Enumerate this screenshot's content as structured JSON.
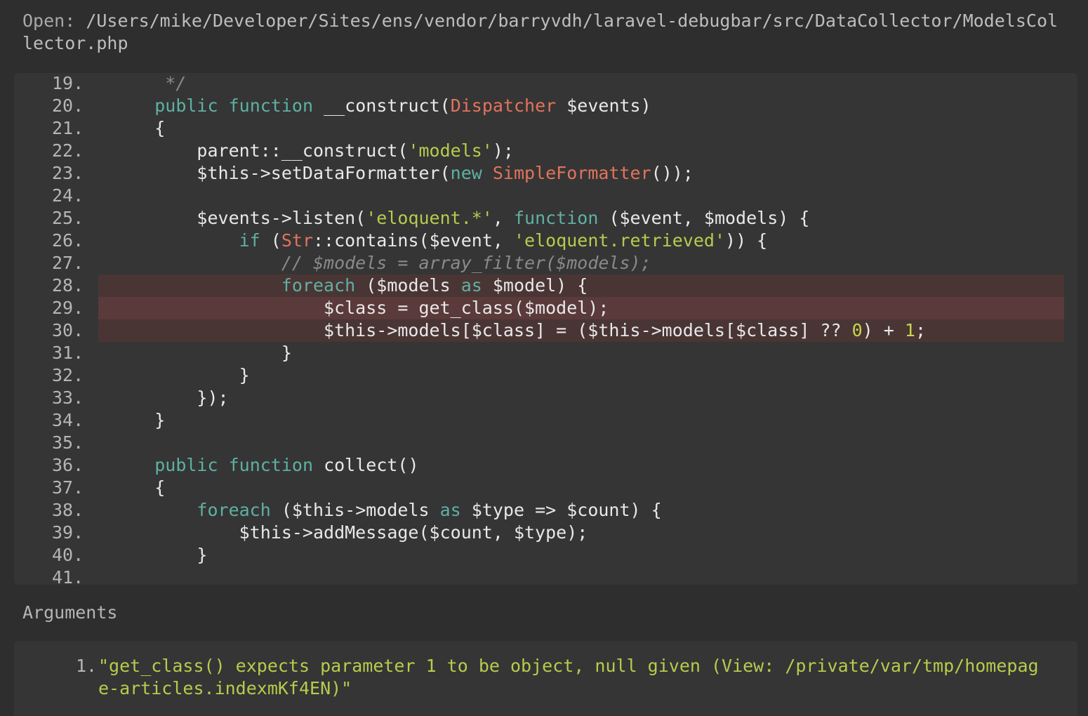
{
  "header": {
    "open_label": "Open:",
    "path": "/Users/mike/Developer/Sites/ens/vendor/barryvdh/laravel-debugbar/src/DataCollector/ModelsCollector.php"
  },
  "code": {
    "highlight_lines": [
      "28",
      "29",
      "30"
    ],
    "active_line": "29",
    "lines": [
      {
        "num": "19.",
        "tokens": [
          {
            "t": "     */",
            "c": "c"
          }
        ]
      },
      {
        "num": "20.",
        "tokens": [
          {
            "t": "    ",
            "c": ""
          },
          {
            "t": "public",
            "c": "k"
          },
          {
            "t": " ",
            "c": ""
          },
          {
            "t": "function",
            "c": "k"
          },
          {
            "t": " __construct(",
            "c": ""
          },
          {
            "t": "Dispatcher",
            "c": "t"
          },
          {
            "t": " $events)",
            "c": ""
          }
        ]
      },
      {
        "num": "21.",
        "tokens": [
          {
            "t": "    {",
            "c": ""
          }
        ]
      },
      {
        "num": "22.",
        "tokens": [
          {
            "t": "        parent::__construct(",
            "c": ""
          },
          {
            "t": "'models'",
            "c": "s"
          },
          {
            "t": ");",
            "c": ""
          }
        ]
      },
      {
        "num": "23.",
        "tokens": [
          {
            "t": "        $this->setDataFormatter(",
            "c": ""
          },
          {
            "t": "new",
            "c": "k"
          },
          {
            "t": " ",
            "c": ""
          },
          {
            "t": "SimpleFormatter",
            "c": "t"
          },
          {
            "t": "());",
            "c": ""
          }
        ]
      },
      {
        "num": "24.",
        "tokens": [
          {
            "t": "",
            "c": ""
          }
        ]
      },
      {
        "num": "25.",
        "tokens": [
          {
            "t": "        $events->listen(",
            "c": ""
          },
          {
            "t": "'eloquent.*'",
            "c": "s"
          },
          {
            "t": ", ",
            "c": ""
          },
          {
            "t": "function",
            "c": "k"
          },
          {
            "t": " ($event, $models) {",
            "c": ""
          }
        ]
      },
      {
        "num": "26.",
        "tokens": [
          {
            "t": "            ",
            "c": ""
          },
          {
            "t": "if",
            "c": "k"
          },
          {
            "t": " (",
            "c": ""
          },
          {
            "t": "Str",
            "c": "t"
          },
          {
            "t": "::contains($event, ",
            "c": ""
          },
          {
            "t": "'eloquent.retrieved'",
            "c": "s"
          },
          {
            "t": ")) {",
            "c": ""
          }
        ]
      },
      {
        "num": "27.",
        "tokens": [
          {
            "t": "                ",
            "c": ""
          },
          {
            "t": "// $models = array_filter($models);",
            "c": "c"
          }
        ]
      },
      {
        "num": "28.",
        "tokens": [
          {
            "t": "                ",
            "c": ""
          },
          {
            "t": "foreach",
            "c": "k"
          },
          {
            "t": " ($models ",
            "c": ""
          },
          {
            "t": "as",
            "c": "k"
          },
          {
            "t": " $model) {",
            "c": ""
          }
        ]
      },
      {
        "num": "29.",
        "tokens": [
          {
            "t": "                    $class = get_class($model);",
            "c": ""
          }
        ]
      },
      {
        "num": "30.",
        "tokens": [
          {
            "t": "                    $this->models[$class] = ($this->models[$class] ?? ",
            "c": ""
          },
          {
            "t": "0",
            "c": "n"
          },
          {
            "t": ") + ",
            "c": ""
          },
          {
            "t": "1",
            "c": "n"
          },
          {
            "t": ";",
            "c": ""
          }
        ]
      },
      {
        "num": "31.",
        "tokens": [
          {
            "t": "                }",
            "c": ""
          }
        ]
      },
      {
        "num": "32.",
        "tokens": [
          {
            "t": "            }",
            "c": ""
          }
        ]
      },
      {
        "num": "33.",
        "tokens": [
          {
            "t": "        });",
            "c": ""
          }
        ]
      },
      {
        "num": "34.",
        "tokens": [
          {
            "t": "    }",
            "c": ""
          }
        ]
      },
      {
        "num": "35.",
        "tokens": [
          {
            "t": "",
            "c": ""
          }
        ]
      },
      {
        "num": "36.",
        "tokens": [
          {
            "t": "    ",
            "c": ""
          },
          {
            "t": "public",
            "c": "k"
          },
          {
            "t": " ",
            "c": ""
          },
          {
            "t": "function",
            "c": "k"
          },
          {
            "t": " collect()",
            "c": ""
          }
        ]
      },
      {
        "num": "37.",
        "tokens": [
          {
            "t": "    {",
            "c": ""
          }
        ]
      },
      {
        "num": "38.",
        "tokens": [
          {
            "t": "        ",
            "c": ""
          },
          {
            "t": "foreach",
            "c": "k"
          },
          {
            "t": " ($this->models ",
            "c": ""
          },
          {
            "t": "as",
            "c": "k"
          },
          {
            "t": " $type => $count) {",
            "c": ""
          }
        ]
      },
      {
        "num": "39.",
        "tokens": [
          {
            "t": "            $this->addMessage($count, $type);",
            "c": ""
          }
        ]
      },
      {
        "num": "40.",
        "tokens": [
          {
            "t": "        }",
            "c": ""
          }
        ]
      },
      {
        "num": "41.",
        "tokens": [
          {
            "t": "",
            "c": ""
          }
        ]
      }
    ]
  },
  "arguments": {
    "label": "Arguments",
    "items": [
      {
        "num": "1.",
        "value": "\"get_class() expects parameter 1 to be object, null given (View: /private/var/tmp/homepage-articles.indexmKf4EN)\""
      }
    ]
  }
}
